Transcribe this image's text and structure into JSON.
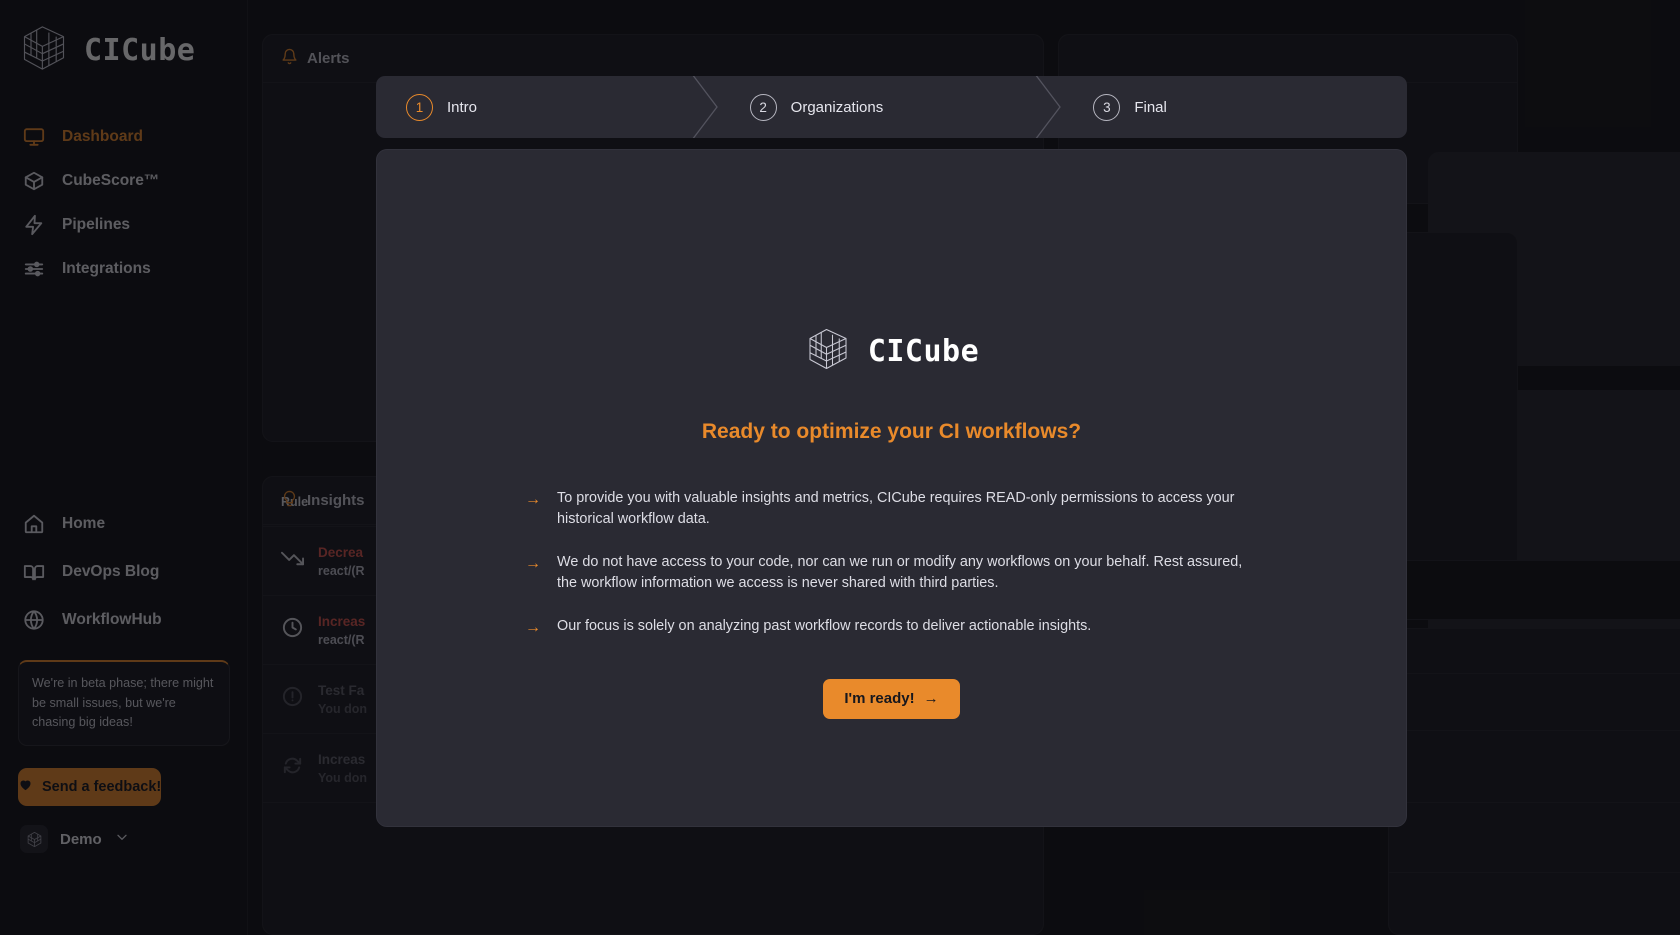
{
  "brand": {
    "name": "CICube",
    "logo_icon": "cube-logo-icon"
  },
  "sidebar": {
    "main_nav": [
      {
        "label": "Dashboard",
        "icon": "monitor-icon",
        "active": true
      },
      {
        "label": "CubeScore™",
        "icon": "box-icon",
        "active": false
      },
      {
        "label": "Pipelines",
        "icon": "lightning-icon",
        "active": false
      },
      {
        "label": "Integrations",
        "icon": "sliders-icon",
        "active": false
      }
    ],
    "bottom_nav": [
      {
        "label": "Home",
        "icon": "home-icon"
      },
      {
        "label": "DevOps Blog",
        "icon": "book-icon"
      },
      {
        "label": "WorkflowHub",
        "icon": "globe-icon"
      }
    ],
    "beta_note": "We're in beta phase; there might be small issues, but we're chasing big ideas!",
    "feedback_button": {
      "label": "Send a feedback!",
      "icon": "heart-icon"
    },
    "org_switcher": {
      "name": "Demo",
      "icon": "cube-avatar-icon",
      "chevron": "chevron-down-icon"
    }
  },
  "background": {
    "alerts_panel": {
      "tab_label": "Alerts",
      "tab_icon": "bell-icon"
    },
    "insights_panel": {
      "tab_label": "Insights",
      "tab_icon": "lightbulb-icon",
      "column_header": "Rule",
      "rows": [
        {
          "title": "Decrea",
          "subtitle": "react/(R",
          "icon": "trending-down-icon",
          "color": "#d8534a"
        },
        {
          "title": "Increas",
          "subtitle": "react/(R",
          "icon": "clock-icon",
          "color": "#d8534a"
        },
        {
          "title": "Test Fa",
          "subtitle": "You don",
          "icon": "alert-circle-icon",
          "color": "#5f5f6b"
        },
        {
          "title": "Increas",
          "subtitle": "You don",
          "icon": "refresh-icon",
          "color": "#5f5f6b"
        }
      ]
    }
  },
  "wizard": {
    "steps": [
      {
        "num": "1",
        "label": "Intro",
        "active": true
      },
      {
        "num": "2",
        "label": "Organizations",
        "active": false
      },
      {
        "num": "3",
        "label": "Final",
        "active": false
      }
    ],
    "logo_name": "CICube",
    "heading": "Ready to optimize your CI workflows?",
    "bullets": [
      "To provide you with valuable insights and metrics, CICube requires READ-only permissions to access your historical workflow data.",
      "We do not have access to your code, nor can we run or modify any workflows on your behalf. Rest assured, the workflow information we access is never shared with third parties.",
      "Our focus is solely on analyzing past workflow records to deliver actionable insights."
    ],
    "cta": {
      "label": "I'm ready!",
      "arrow": "→",
      "icon": "arrow-right-icon"
    }
  },
  "colors": {
    "accent": "#e98a2b",
    "modal_bg": "#2a2a33",
    "app_bg": "#121216",
    "sidebar_bg": "#121217",
    "danger": "#d8534a"
  }
}
